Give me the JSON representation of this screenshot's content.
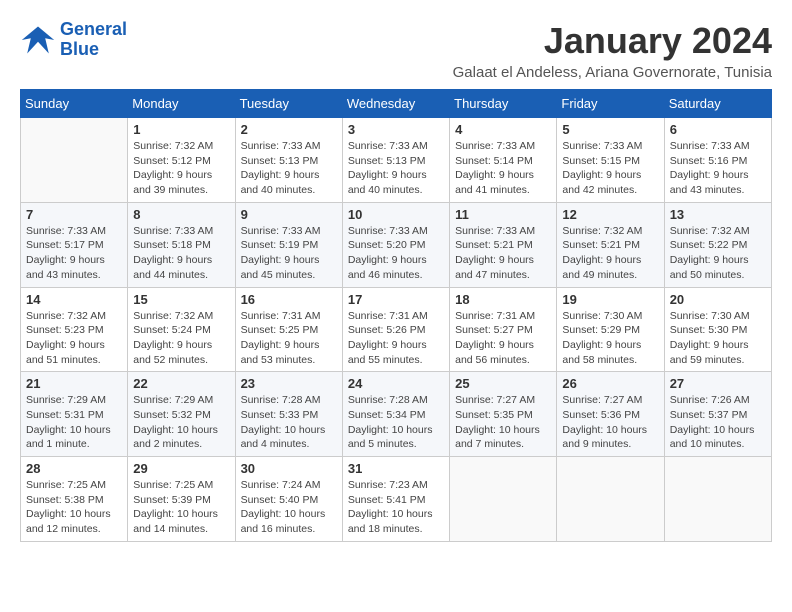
{
  "logo": {
    "text_general": "General",
    "text_blue": "Blue"
  },
  "title": "January 2024",
  "subtitle": "Galaat el Andeless, Ariana Governorate, Tunisia",
  "days_of_week": [
    "Sunday",
    "Monday",
    "Tuesday",
    "Wednesday",
    "Thursday",
    "Friday",
    "Saturday"
  ],
  "weeks": [
    [
      {
        "day": "",
        "sunrise": "",
        "sunset": "",
        "daylight": ""
      },
      {
        "day": "1",
        "sunrise": "Sunrise: 7:32 AM",
        "sunset": "Sunset: 5:12 PM",
        "daylight": "Daylight: 9 hours and 39 minutes."
      },
      {
        "day": "2",
        "sunrise": "Sunrise: 7:33 AM",
        "sunset": "Sunset: 5:13 PM",
        "daylight": "Daylight: 9 hours and 40 minutes."
      },
      {
        "day": "3",
        "sunrise": "Sunrise: 7:33 AM",
        "sunset": "Sunset: 5:13 PM",
        "daylight": "Daylight: 9 hours and 40 minutes."
      },
      {
        "day": "4",
        "sunrise": "Sunrise: 7:33 AM",
        "sunset": "Sunset: 5:14 PM",
        "daylight": "Daylight: 9 hours and 41 minutes."
      },
      {
        "day": "5",
        "sunrise": "Sunrise: 7:33 AM",
        "sunset": "Sunset: 5:15 PM",
        "daylight": "Daylight: 9 hours and 42 minutes."
      },
      {
        "day": "6",
        "sunrise": "Sunrise: 7:33 AM",
        "sunset": "Sunset: 5:16 PM",
        "daylight": "Daylight: 9 hours and 43 minutes."
      }
    ],
    [
      {
        "day": "7",
        "sunrise": "Sunrise: 7:33 AM",
        "sunset": "Sunset: 5:17 PM",
        "daylight": "Daylight: 9 hours and 43 minutes."
      },
      {
        "day": "8",
        "sunrise": "Sunrise: 7:33 AM",
        "sunset": "Sunset: 5:18 PM",
        "daylight": "Daylight: 9 hours and 44 minutes."
      },
      {
        "day": "9",
        "sunrise": "Sunrise: 7:33 AM",
        "sunset": "Sunset: 5:19 PM",
        "daylight": "Daylight: 9 hours and 45 minutes."
      },
      {
        "day": "10",
        "sunrise": "Sunrise: 7:33 AM",
        "sunset": "Sunset: 5:20 PM",
        "daylight": "Daylight: 9 hours and 46 minutes."
      },
      {
        "day": "11",
        "sunrise": "Sunrise: 7:33 AM",
        "sunset": "Sunset: 5:21 PM",
        "daylight": "Daylight: 9 hours and 47 minutes."
      },
      {
        "day": "12",
        "sunrise": "Sunrise: 7:32 AM",
        "sunset": "Sunset: 5:21 PM",
        "daylight": "Daylight: 9 hours and 49 minutes."
      },
      {
        "day": "13",
        "sunrise": "Sunrise: 7:32 AM",
        "sunset": "Sunset: 5:22 PM",
        "daylight": "Daylight: 9 hours and 50 minutes."
      }
    ],
    [
      {
        "day": "14",
        "sunrise": "Sunrise: 7:32 AM",
        "sunset": "Sunset: 5:23 PM",
        "daylight": "Daylight: 9 hours and 51 minutes."
      },
      {
        "day": "15",
        "sunrise": "Sunrise: 7:32 AM",
        "sunset": "Sunset: 5:24 PM",
        "daylight": "Daylight: 9 hours and 52 minutes."
      },
      {
        "day": "16",
        "sunrise": "Sunrise: 7:31 AM",
        "sunset": "Sunset: 5:25 PM",
        "daylight": "Daylight: 9 hours and 53 minutes."
      },
      {
        "day": "17",
        "sunrise": "Sunrise: 7:31 AM",
        "sunset": "Sunset: 5:26 PM",
        "daylight": "Daylight: 9 hours and 55 minutes."
      },
      {
        "day": "18",
        "sunrise": "Sunrise: 7:31 AM",
        "sunset": "Sunset: 5:27 PM",
        "daylight": "Daylight: 9 hours and 56 minutes."
      },
      {
        "day": "19",
        "sunrise": "Sunrise: 7:30 AM",
        "sunset": "Sunset: 5:29 PM",
        "daylight": "Daylight: 9 hours and 58 minutes."
      },
      {
        "day": "20",
        "sunrise": "Sunrise: 7:30 AM",
        "sunset": "Sunset: 5:30 PM",
        "daylight": "Daylight: 9 hours and 59 minutes."
      }
    ],
    [
      {
        "day": "21",
        "sunrise": "Sunrise: 7:29 AM",
        "sunset": "Sunset: 5:31 PM",
        "daylight": "Daylight: 10 hours and 1 minute."
      },
      {
        "day": "22",
        "sunrise": "Sunrise: 7:29 AM",
        "sunset": "Sunset: 5:32 PM",
        "daylight": "Daylight: 10 hours and 2 minutes."
      },
      {
        "day": "23",
        "sunrise": "Sunrise: 7:28 AM",
        "sunset": "Sunset: 5:33 PM",
        "daylight": "Daylight: 10 hours and 4 minutes."
      },
      {
        "day": "24",
        "sunrise": "Sunrise: 7:28 AM",
        "sunset": "Sunset: 5:34 PM",
        "daylight": "Daylight: 10 hours and 5 minutes."
      },
      {
        "day": "25",
        "sunrise": "Sunrise: 7:27 AM",
        "sunset": "Sunset: 5:35 PM",
        "daylight": "Daylight: 10 hours and 7 minutes."
      },
      {
        "day": "26",
        "sunrise": "Sunrise: 7:27 AM",
        "sunset": "Sunset: 5:36 PM",
        "daylight": "Daylight: 10 hours and 9 minutes."
      },
      {
        "day": "27",
        "sunrise": "Sunrise: 7:26 AM",
        "sunset": "Sunset: 5:37 PM",
        "daylight": "Daylight: 10 hours and 10 minutes."
      }
    ],
    [
      {
        "day": "28",
        "sunrise": "Sunrise: 7:25 AM",
        "sunset": "Sunset: 5:38 PM",
        "daylight": "Daylight: 10 hours and 12 minutes."
      },
      {
        "day": "29",
        "sunrise": "Sunrise: 7:25 AM",
        "sunset": "Sunset: 5:39 PM",
        "daylight": "Daylight: 10 hours and 14 minutes."
      },
      {
        "day": "30",
        "sunrise": "Sunrise: 7:24 AM",
        "sunset": "Sunset: 5:40 PM",
        "daylight": "Daylight: 10 hours and 16 minutes."
      },
      {
        "day": "31",
        "sunrise": "Sunrise: 7:23 AM",
        "sunset": "Sunset: 5:41 PM",
        "daylight": "Daylight: 10 hours and 18 minutes."
      },
      {
        "day": "",
        "sunrise": "",
        "sunset": "",
        "daylight": ""
      },
      {
        "day": "",
        "sunrise": "",
        "sunset": "",
        "daylight": ""
      },
      {
        "day": "",
        "sunrise": "",
        "sunset": "",
        "daylight": ""
      }
    ]
  ]
}
